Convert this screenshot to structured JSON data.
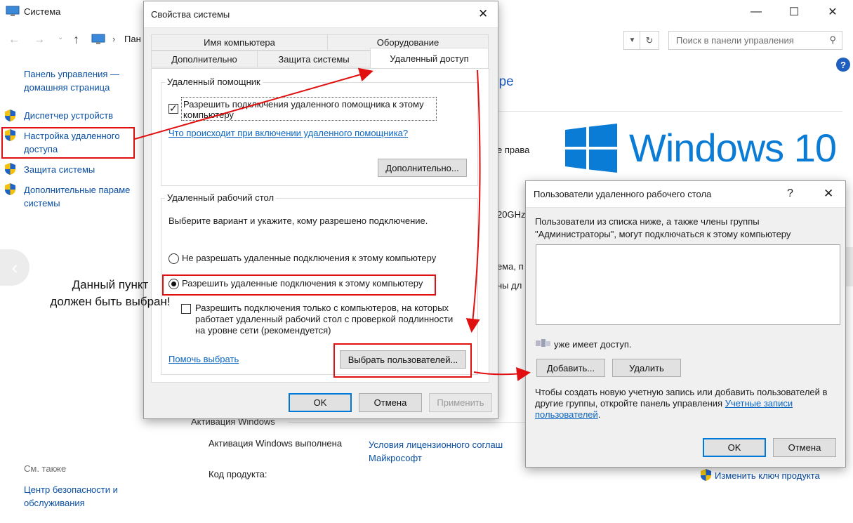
{
  "system_window": {
    "title": "Система",
    "address_partial": "Пан",
    "search_placeholder": "Поиск в панели управления",
    "header_partial": "ере",
    "sidebar": {
      "home_line1": "Панель управления —",
      "home_line2": "домашняя страница",
      "items": [
        {
          "line1": "Диспетчер устройств",
          "line2": ""
        },
        {
          "line1": "Настройка удаленного",
          "line2": "доступа"
        },
        {
          "line1": "Защита системы",
          "line2": ""
        },
        {
          "line1": "Дополнительные параме",
          "line2": "системы"
        }
      ],
      "see_also": "См. также",
      "security_line1": "Центр безопасности и",
      "security_line2": "обслуживания"
    },
    "partial_texts": {
      "rights": "е права",
      "ghz": "20GHz",
      "sys": "ема, п",
      "disp": "ны дл"
    },
    "brand": "Windows 10",
    "activation": {
      "heading": "Активация Windows",
      "status": "Активация Windows выполнена",
      "license_line1": "Условия лицензионного соглаш",
      "license_line2": "Майкрософт",
      "product_key_label": "Код продукта:",
      "change_key": "Изменить ключ продукта"
    }
  },
  "sysprops_dialog": {
    "title": "Свойства системы",
    "tabs_row1": [
      "Имя компьютера",
      "Оборудование"
    ],
    "tabs_row2": [
      "Дополнительно",
      "Защита системы",
      "Удаленный доступ"
    ],
    "remote_assistant": {
      "group_label": "Удаленный помощник",
      "allow_line1": "Разрешить подключения удаленного помощника к этому",
      "allow_line2": "компьютеру",
      "allow_checked": true,
      "what_link": "Что происходит при включении удаленного помощника?",
      "advanced_button": "Дополнительно..."
    },
    "remote_desktop": {
      "group_label": "Удаленный рабочий стол",
      "instruction": "Выберите вариант и укажите, кому разрешено подключение.",
      "deny_option": "Не разрешать удаленные подключения к этому компьютеру",
      "allow_option": "Разрешить удаленные подключения к этому компьютеру",
      "selected": "allow",
      "nla_line1": "Разрешить подключения только с компьютеров, на которых",
      "nla_line2": "работает удаленный рабочий стол с проверкой подлинности",
      "nla_line3": "на уровне сети (рекомендуется)",
      "nla_checked": false,
      "help_link": "Помочь выбрать",
      "select_users_button": "Выбрать пользователей..."
    },
    "ok": "OK",
    "cancel": "Отмена",
    "apply": "Применить"
  },
  "annotation": {
    "line1": "Данный пункт",
    "line2": "должен быть выбран!",
    "color": "#e01010"
  },
  "rdu_dialog": {
    "title": "Пользователи удаленного рабочего стола",
    "help": "?",
    "desc_line1": "Пользователи из списка ниже, а также члены группы",
    "desc_line2": "\"Администраторы\", могут подключаться к этому компьютеру",
    "access_text": "уже имеет доступ.",
    "add_button": "Добавить...",
    "remove_button": "Удалить",
    "footer_line1": "Чтобы создать новую учетную запись или добавить пользователей в",
    "footer_line2_prefix": "другие группы, откройте панель управления ",
    "footer_link1": "Учетные записи",
    "footer_link2": "пользователей",
    "footer_suffix": ".",
    "ok": "OK",
    "cancel": "Отмена"
  }
}
